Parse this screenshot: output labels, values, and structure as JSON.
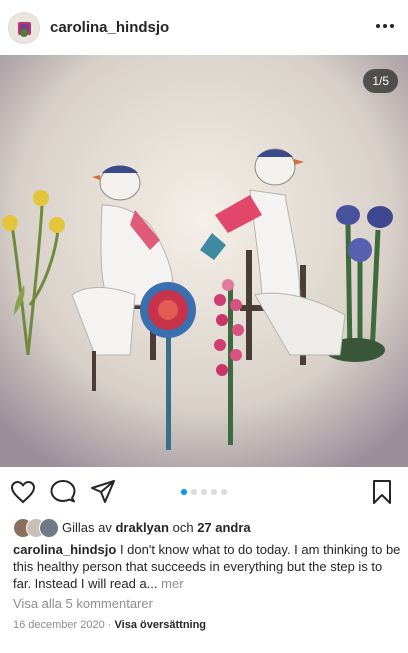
{
  "post": {
    "username": "carolina_hindsjo",
    "more_icon": "three-dots-icon",
    "image_counter": "1/5",
    "carousel": {
      "total": 5,
      "current": 1
    }
  },
  "actions": {
    "like_icon": "heart-icon",
    "comment_icon": "comment-icon",
    "share_icon": "paper-plane-icon",
    "save_icon": "bookmark-icon"
  },
  "likes": {
    "prefix": "Gillas av",
    "user": "draklyan",
    "connector": "och",
    "others": "27 andra"
  },
  "caption": {
    "username": "carolina_hindsjo",
    "text": "I don't know what to do today. I am thinking to be this healthy person that succeeds in everything but the step is to far. Instead I will read a...",
    "more": "mer"
  },
  "comments_link": "Visa alla 5 kommentarer",
  "date": "16 december 2020",
  "separator": "·",
  "translate": "Visa översättning",
  "colors": {
    "accent": "#0095f6",
    "muted": "#8e8e8e",
    "text": "#262626"
  }
}
